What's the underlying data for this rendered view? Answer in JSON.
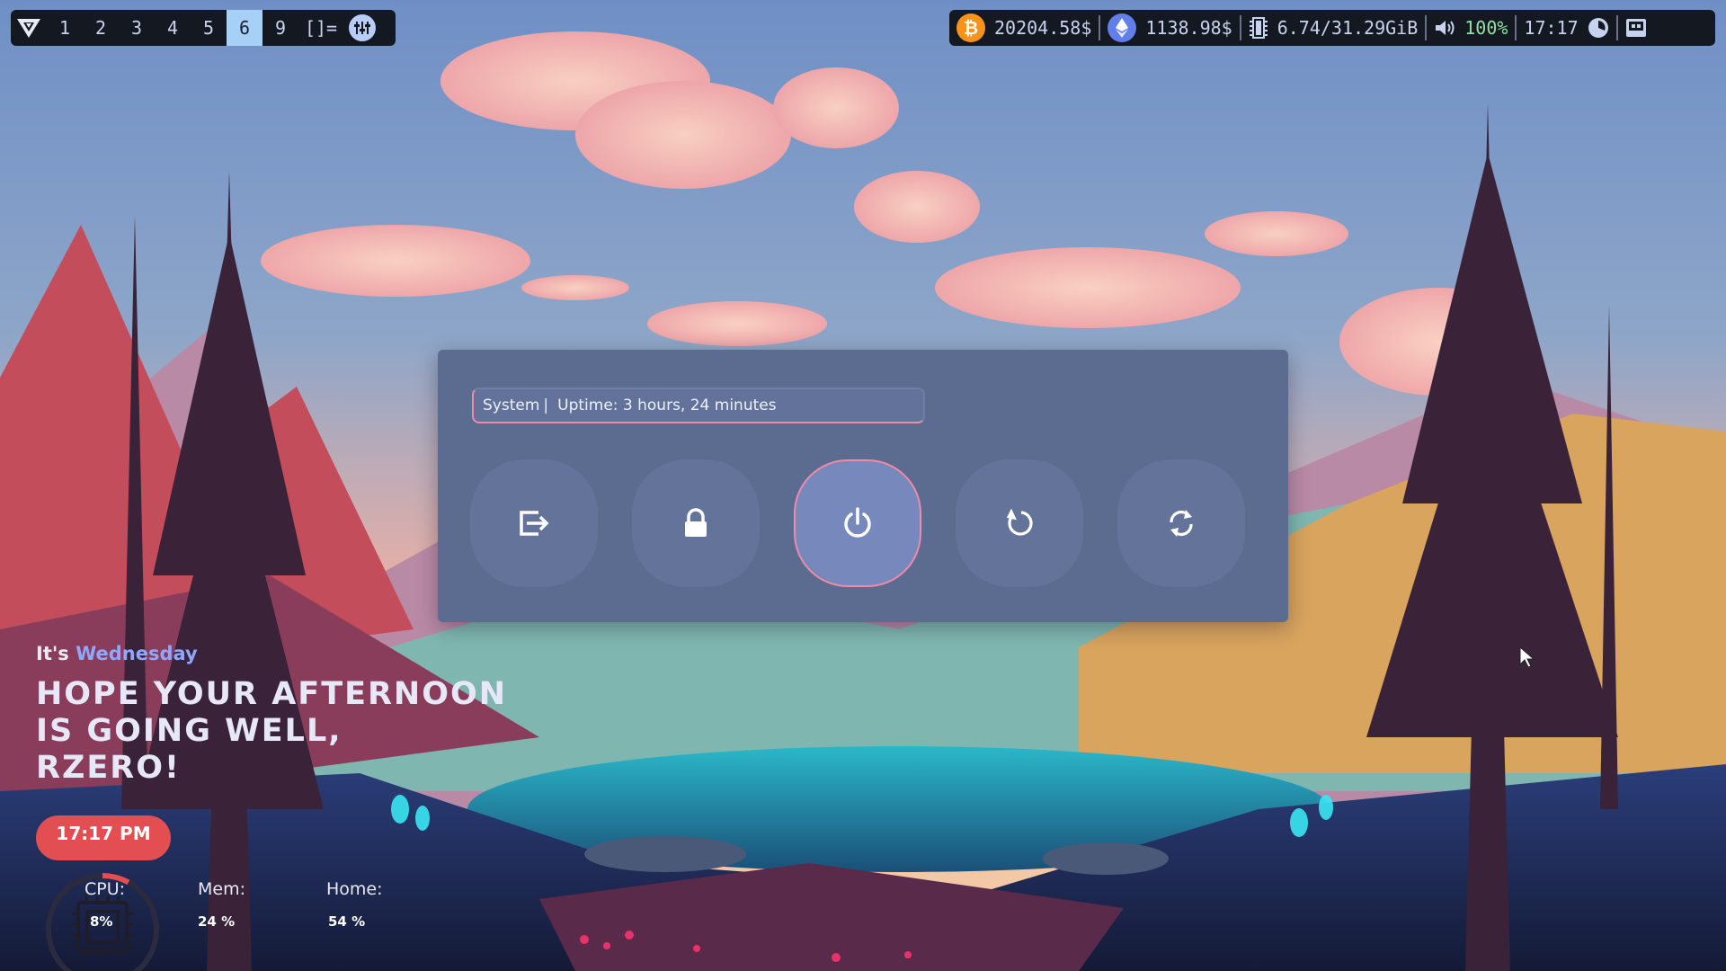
{
  "topbar": {
    "workspaces": [
      "1",
      "2",
      "3",
      "4",
      "5",
      "6",
      "9"
    ],
    "active_workspace": "6",
    "layout_symbol": "[]=",
    "btc": {
      "value": "20204.58$",
      "icon": "bitcoin-icon"
    },
    "eth": {
      "value": "1138.98$",
      "icon": "ethereum-icon"
    },
    "memory": {
      "value": "6.74/31.29GiB",
      "icon": "memory-icon"
    },
    "volume": {
      "value": "100%",
      "icon": "volume-icon"
    },
    "clock": {
      "value": "17:17",
      "icon": "clock-icon"
    },
    "tray_icon": "tray-icon"
  },
  "power_menu": {
    "prompt_label": "System",
    "prompt_divider": "|",
    "prompt_text": "Uptime: 3 hours, 24 minutes",
    "actions": [
      {
        "name": "logout",
        "icon": "logout-icon"
      },
      {
        "name": "lock",
        "icon": "lock-icon"
      },
      {
        "name": "shutdown",
        "icon": "power-icon",
        "selected": true
      },
      {
        "name": "reboot",
        "icon": "reboot-icon"
      },
      {
        "name": "suspend",
        "icon": "suspend-icon"
      }
    ]
  },
  "greeting": {
    "prefix": "It's",
    "day": "Wednesday",
    "line1": "HOPE YOUR AFTERNOON",
    "line2": "IS GOING WELL,",
    "line3": "RZERO!",
    "time": "17:17 PM"
  },
  "stats": {
    "cpu_label": "CPU:",
    "cpu_value": "8%",
    "cpu_fraction": 0.08,
    "mem_label": "Mem:",
    "mem_value": "24 %",
    "home_label": "Home:",
    "home_value": "54 %"
  },
  "colors": {
    "accent_pink": "#f08aa8",
    "menu_bg": "#5c6b90",
    "time_pill": "#e24e52",
    "day_highlight": "#8fa7ff",
    "active_workspace": "#a6d0f5"
  }
}
